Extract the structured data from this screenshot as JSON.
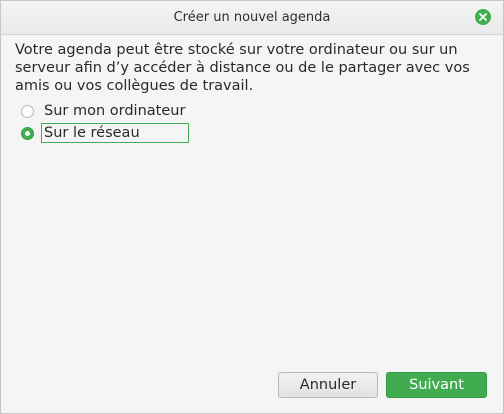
{
  "window": {
    "title": "Créer un nouvel agenda"
  },
  "main": {
    "description": "Votre agenda peut être stocké sur votre ordinateur ou sur un serveur afin d’y accéder à distance ou de le partager avec vos amis ou vos collègues de travail.",
    "options": [
      {
        "label": "Sur mon ordinateur",
        "selected": false
      },
      {
        "label": "Sur le réseau",
        "selected": true
      }
    ]
  },
  "footer": {
    "cancel_label": "Annuler",
    "next_label": "Suivant"
  },
  "colors": {
    "accent": "#3eae4f"
  },
  "icons": {
    "close": "close-icon"
  }
}
